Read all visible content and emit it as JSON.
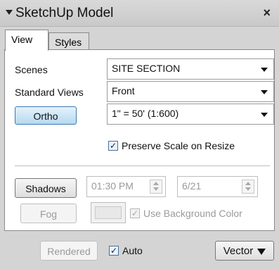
{
  "window": {
    "title": "SketchUp Model",
    "close_label": "×"
  },
  "tabs": [
    {
      "label": "View"
    },
    {
      "label": "Styles"
    }
  ],
  "scenes": {
    "label": "Scenes",
    "value": "SITE SECTION"
  },
  "standard_views": {
    "label": "Standard Views",
    "value": "Front"
  },
  "ortho": {
    "label": "Ortho",
    "scale_value": "1\" = 50' (1:600)"
  },
  "preserve_scale": {
    "label": "Preserve Scale on Resize",
    "checked": true
  },
  "shadows": {
    "label": "Shadows",
    "time": "01:30 PM",
    "date": "6/21"
  },
  "fog": {
    "label": "Fog",
    "use_background_label": "Use Background Color",
    "checked": true
  },
  "footer": {
    "rendered_label": "Rendered",
    "auto_label": "Auto",
    "auto_checked": true,
    "vector_label": "Vector"
  },
  "check_mark": "✓"
}
